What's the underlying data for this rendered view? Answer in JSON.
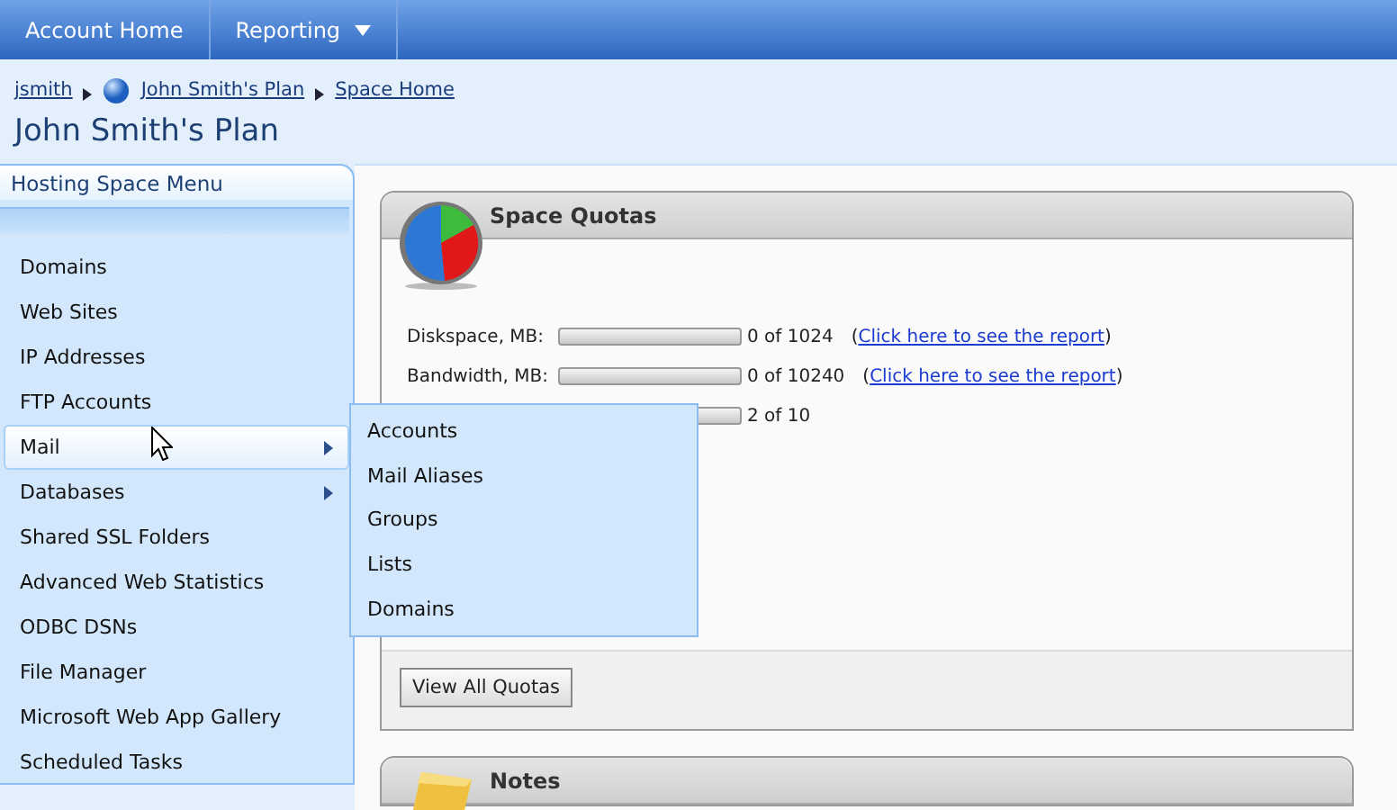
{
  "nav": [
    {
      "label": "Account Home",
      "dropdown": false
    },
    {
      "label": "Reporting",
      "dropdown": true
    }
  ],
  "breadcrumb": [
    {
      "label": "jsmith",
      "kind": "link"
    },
    {
      "label": "John Smith's Plan",
      "kind": "space"
    },
    {
      "label": "Space Home",
      "kind": "link"
    }
  ],
  "page_title": "John Smith's Plan",
  "sidebar": {
    "title": "Hosting Space Menu",
    "items": [
      {
        "label": "Domains",
        "selected": false,
        "submenu": false
      },
      {
        "label": "Web Sites",
        "selected": false,
        "submenu": false
      },
      {
        "label": "IP Addresses",
        "selected": false,
        "submenu": false
      },
      {
        "label": "FTP Accounts",
        "selected": false,
        "submenu": false
      },
      {
        "label": "Mail",
        "selected": true,
        "submenu": true
      },
      {
        "label": "Databases",
        "selected": false,
        "submenu": true
      },
      {
        "label": "Shared SSL Folders",
        "selected": false,
        "submenu": false
      },
      {
        "label": "Advanced Web Statistics",
        "selected": false,
        "submenu": false
      },
      {
        "label": "ODBC DSNs",
        "selected": false,
        "submenu": false
      },
      {
        "label": "File Manager",
        "selected": false,
        "submenu": false
      },
      {
        "label": "Microsoft Web App Gallery",
        "selected": false,
        "submenu": false
      },
      {
        "label": "Scheduled Tasks",
        "selected": false,
        "submenu": false
      }
    ]
  },
  "submenu": [
    "Accounts",
    "Mail Aliases",
    "Groups",
    "Lists",
    "Domains"
  ],
  "quotas": {
    "title": "Space Quotas",
    "rows": [
      {
        "label": "Diskspace, MB:",
        "level": 0,
        "reading": "0 of 1024",
        "link_open": "(",
        "link": "Click here to see the report",
        "link_close": ")"
      },
      {
        "label": "Bandwidth, MB:",
        "level": 0,
        "reading": "0 of 10240",
        "link_open": "(",
        "link": "Click here to see the report",
        "link_close": ")"
      },
      {
        "reading": "2 of 10"
      }
    ],
    "button": "View All Quotas"
  },
  "notes": {
    "title": "Notes"
  }
}
